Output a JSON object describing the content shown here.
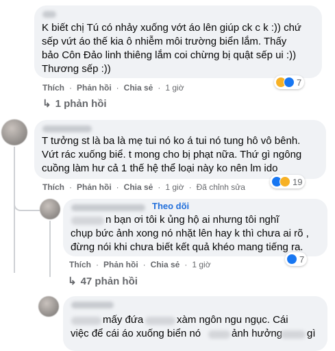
{
  "comments": [
    {
      "text": "K biết chị Tú có nhảy xuống vớt áo lên giúp ck c k :)) chứ\nsếp vứt áo thế kia ô nhiễm môi trường biển lắm. Thấy\nbảo Côn Đảo linh thiêng lắm coi chừng bị quật sếp ui :))\nThương sếp :))",
      "actions": {
        "like": "Thích",
        "reply": "Phản hồi",
        "share": "Chia sẻ",
        "time": "1 giờ"
      },
      "reactions": {
        "count": "7",
        "icons": [
          "haha-icon",
          "like-icon"
        ]
      },
      "replies_label": "1 phản hồi"
    },
    {
      "text": "T tưởng st là ba là mẹ tui nó ko á tui nó tung hô vô bênh.\nVứt rác xuống biể. t mong cho bị phạt nữa. Thứ gì ngông\ncuồng làm hư cả 1 thế hệ thể loại này ko nên lm ido",
      "actions": {
        "like": "Thích",
        "reply": "Phản hồi",
        "share": "Chia sẻ",
        "time": "1 giờ",
        "edited": "Đã chỉnh sửa"
      },
      "reactions": {
        "count": "19",
        "icons": [
          "like-icon",
          "haha-icon"
        ]
      },
      "reply": {
        "follow_label": "Theo dõi",
        "text_line1": "n bạn ơi tôi k ủng hộ ai nhưng tôi nghĩ",
        "text_rest": "chụp bức ảnh xong nó nhặt lên hay k thì chưa ai rõ ,\nđừng nói khi chưa biết kết quả khéo mang tiếng ra.",
        "actions": {
          "like": "Thích",
          "reply": "Phản hồi",
          "share": "Chia sẻ",
          "time": "1 giờ"
        },
        "reactions": {
          "count": "7",
          "icons": [
            "like-icon"
          ]
        }
      },
      "replies_label": "47 phản hồi"
    },
    {
      "text_line1_a": "mấy đứa",
      "text_line1_b": "xàm ngôn ngu ngục. Cái",
      "text_line2_a": "việc để cái áo xuống biển nó",
      "text_line2_b": "ảnh hưởng",
      "text_line2_c": "gì"
    }
  ],
  "colors": {
    "bubble": "#f0f2f5",
    "meta": "#65676b",
    "link": "#216fdb",
    "like": "#1877f2",
    "haha": "#f7b125"
  }
}
